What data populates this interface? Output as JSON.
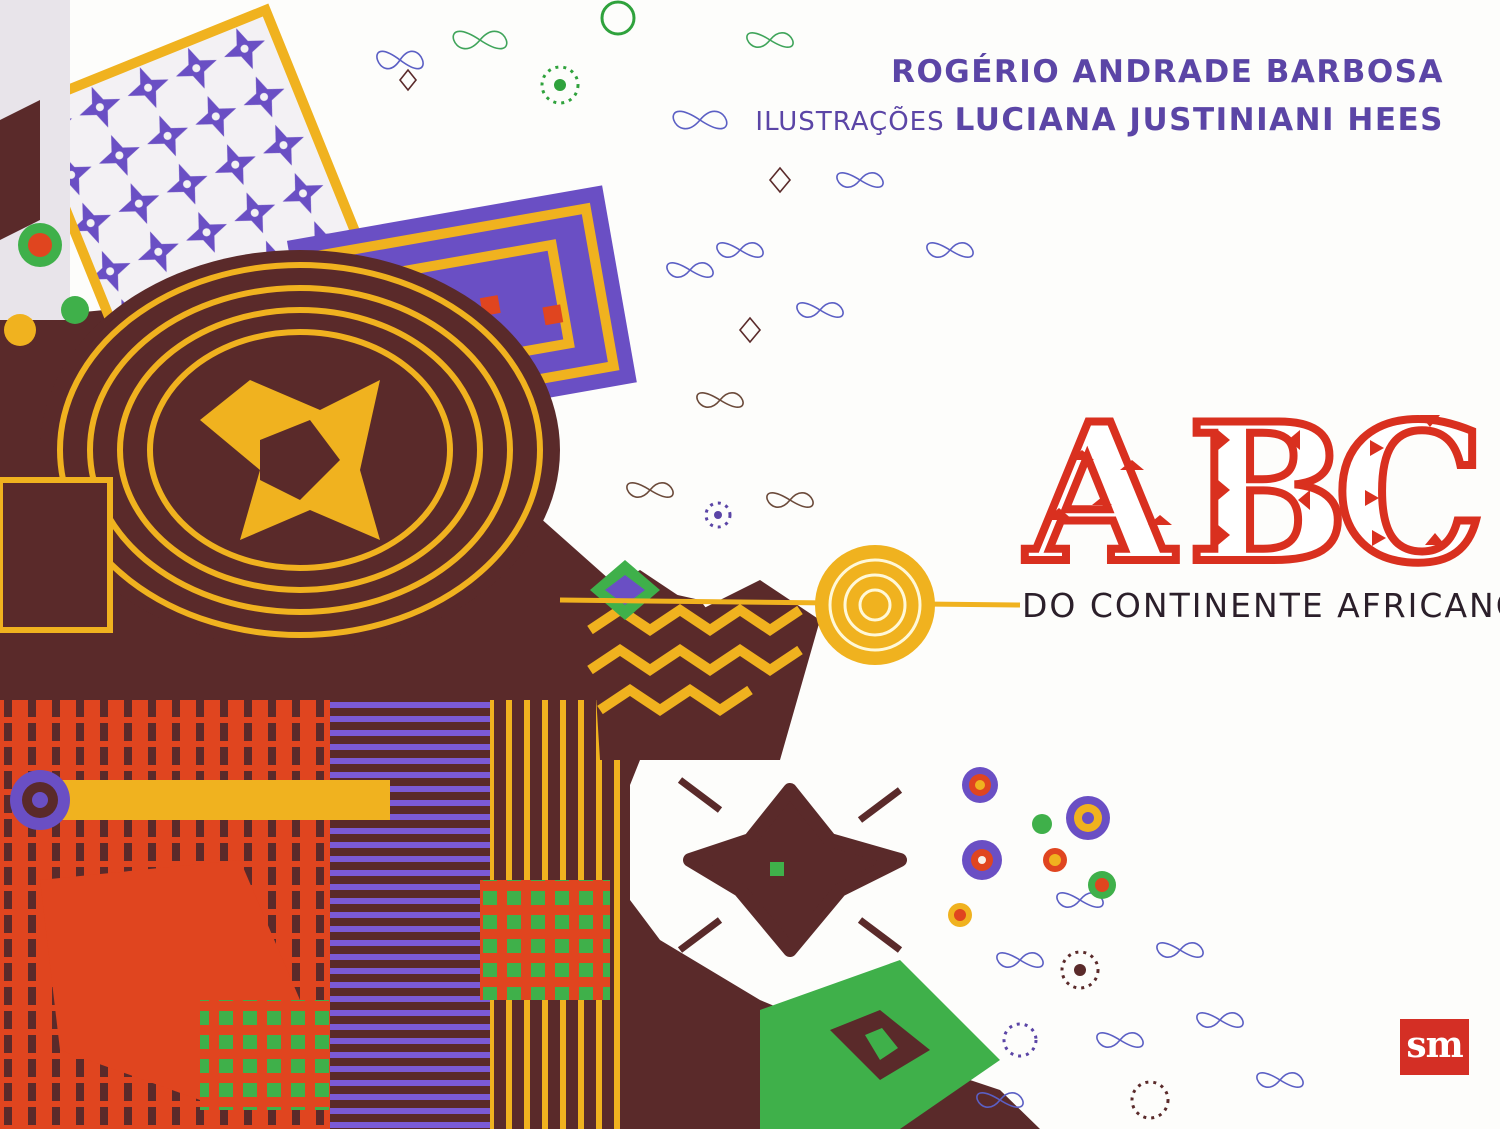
{
  "cover": {
    "author": "ROGÉRIO ANDRADE BARBOSA",
    "illustrations_label": "ILUSTRAÇÕES",
    "illustrator": "LUCIANA JUSTINIANI HEES",
    "title_letters": [
      "A",
      "B",
      "C"
    ],
    "subtitle": "DO CONTINENTE AFRICANO",
    "publisher_logo": "sm"
  },
  "colors": {
    "title_red": "#d9301f",
    "text_purple": "#5b45a6",
    "subtitle_dark": "#2b1f2a",
    "publisher_red": "#d42f25",
    "art_maroon": "#5a2a2a",
    "art_gold": "#f0b21f",
    "art_orange": "#e0451f",
    "art_violet": "#6a4fc4",
    "art_green": "#2fa23c"
  }
}
